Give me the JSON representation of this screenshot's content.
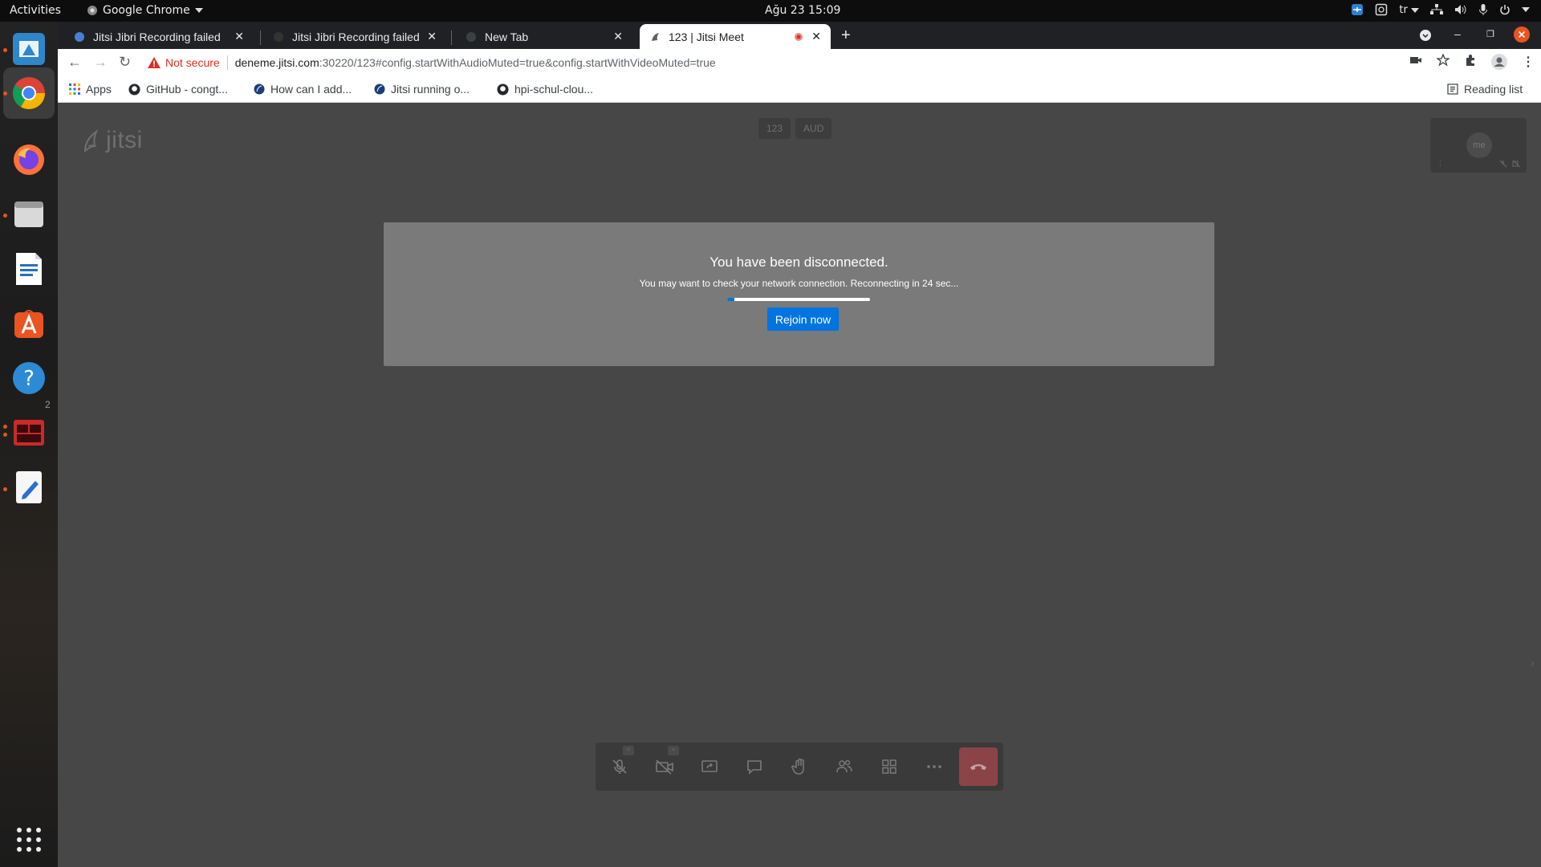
{
  "topbar": {
    "activities": "Activities",
    "app_name": "Google Chrome",
    "clock": "Ağu 23  15:09",
    "lang": "tr"
  },
  "dock": {
    "items": [
      "jitsi-app-icon",
      "chrome-icon",
      "firefox-icon",
      "files-icon",
      "writer-icon",
      "app-center-icon",
      "help-icon",
      "terminal-app-icon",
      "text-editor-icon"
    ],
    "badge": "2",
    "apps_grid": "show-applications-icon"
  },
  "tabs": [
    {
      "title": "Jitsi Jibri Recording failed"
    },
    {
      "title": "Jitsi Jibri Recording failed"
    },
    {
      "title": "New Tab"
    },
    {
      "title": "123 | Jitsi Meet"
    }
  ],
  "omnibox": {
    "security": "Not secure",
    "host": "deneme.jitsi.com",
    "path": ":30220/123#config.startWithAudioMuted=true&config.startWithVideoMuted=true"
  },
  "bookmarks": {
    "apps": "Apps",
    "items": [
      {
        "label": "GitHub - congt..."
      },
      {
        "label": "How can I add..."
      },
      {
        "label": "Jitsi running o..."
      },
      {
        "label": "hpi-schul-clou..."
      }
    ],
    "reading_list": "Reading list"
  },
  "jitsi": {
    "logo": "jitsi",
    "subject": "123",
    "subject_badge": "AUD",
    "self_avatar": "me",
    "dialog": {
      "title": "You have been disconnected.",
      "message": "You may want to check your network connection. Reconnecting in 24 sec...",
      "progress": 0.05,
      "rejoin": "Rejoin now"
    }
  },
  "colors": {
    "accent": "#0074e0",
    "hangup": "#8a4448",
    "warning": "#d93025",
    "ubuntu_orange": "#e95420"
  }
}
